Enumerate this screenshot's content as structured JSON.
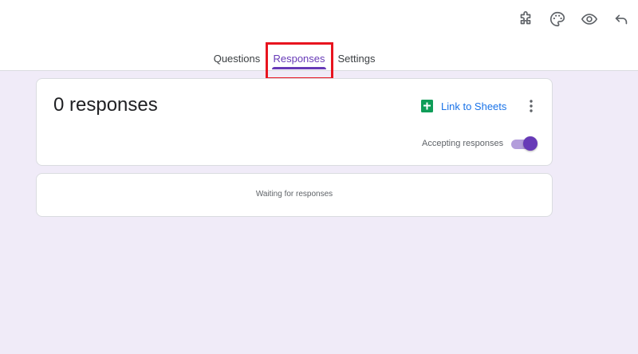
{
  "toolbar": {
    "icons": [
      "addon-icon",
      "palette-icon",
      "preview-eye-icon",
      "undo-icon"
    ]
  },
  "tabs": [
    {
      "label": "Questions",
      "active": false
    },
    {
      "label": "Responses",
      "active": true
    },
    {
      "label": "Settings",
      "active": false
    }
  ],
  "summary": {
    "count_label": "0 responses",
    "link_sheets_label": "Link to Sheets",
    "accepting_label": "Accepting responses",
    "accepting": true
  },
  "waiting": {
    "text": "Waiting for responses"
  },
  "colors": {
    "accent": "#673ab7",
    "accent_light": "#b39ddb",
    "link": "#1a73e8",
    "sheets_green": "#0f9d58",
    "background": "#f0ebf8",
    "highlight": "#e8141f"
  }
}
